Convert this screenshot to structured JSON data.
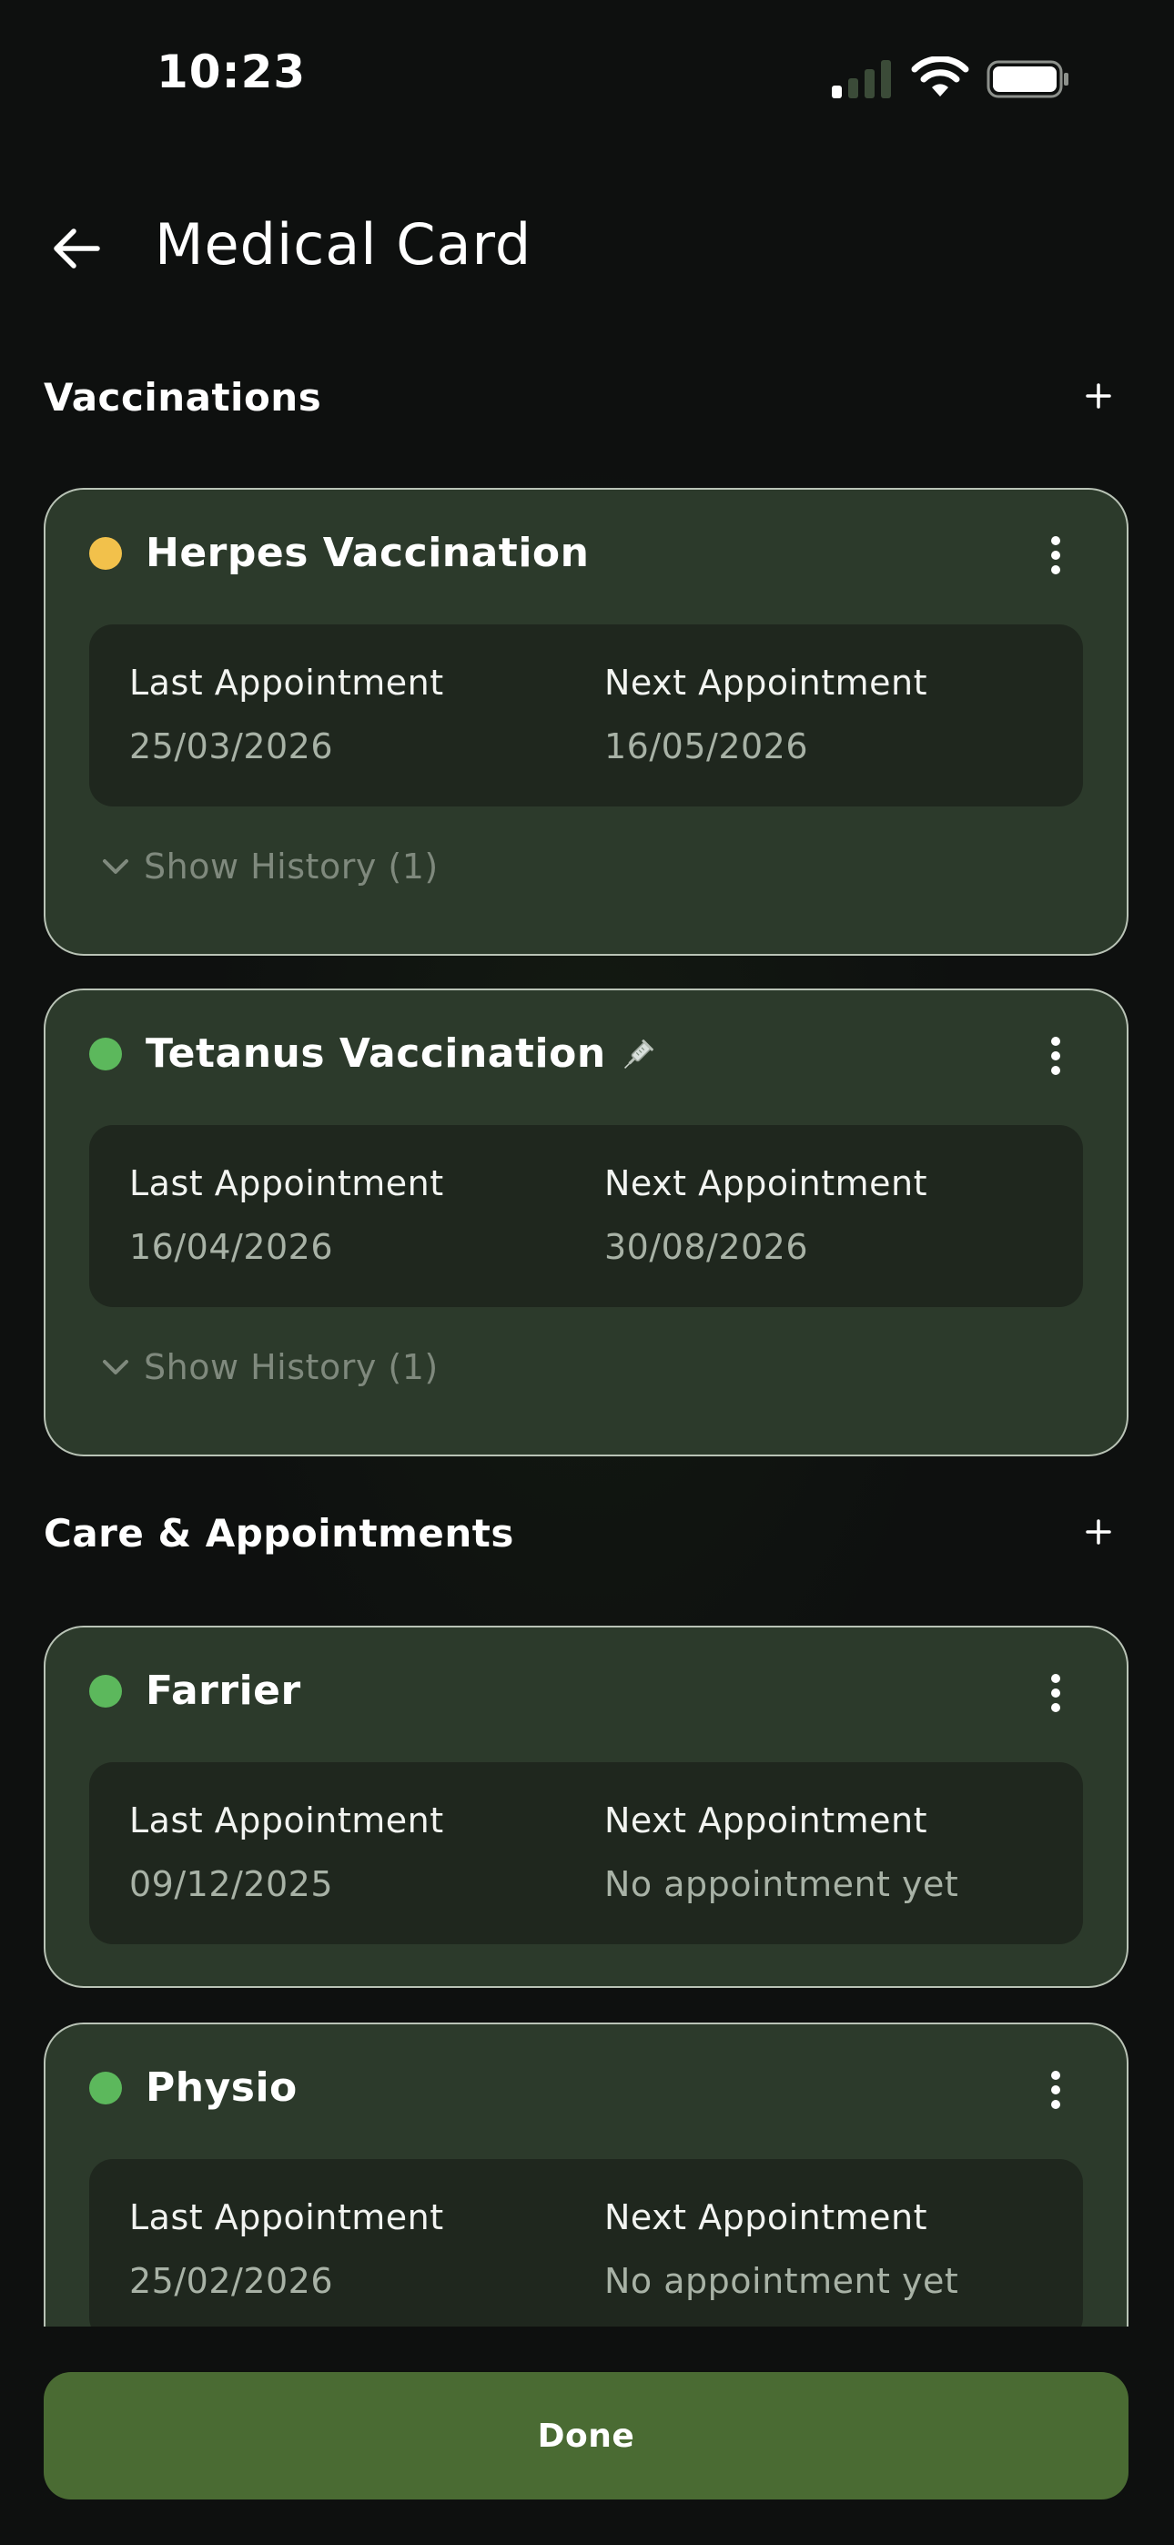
{
  "status_bar": {
    "time": "10:23"
  },
  "header": {
    "title": "Medical Card",
    "back_icon": "arrow-left-icon"
  },
  "sections": {
    "vaccinations": {
      "title": "Vaccinations",
      "add_icon": "plus-icon"
    },
    "care": {
      "title": "Care & Appointments",
      "add_icon": "plus-icon"
    }
  },
  "labels": {
    "last": "Last Appointment",
    "next": "Next Appointment"
  },
  "cards": [
    {
      "title": "Herpes Vaccination",
      "status_color": "#f2c14b",
      "last": "25/03/2026",
      "next": "16/05/2026",
      "history": "Show History (1)"
    },
    {
      "title": "Tetanus Vaccination",
      "status_color": "#5cb85c",
      "last": "16/04/2026",
      "next": "30/08/2026",
      "history": "Show History (1)",
      "icon": "syringe-icon"
    },
    {
      "title": "Farrier",
      "status_color": "#5cb85c",
      "last": "09/12/2025",
      "next": "No appointment yet"
    },
    {
      "title": "Physio",
      "status_color": "#5cb85c",
      "last": "25/02/2026",
      "next": "No appointment yet"
    }
  ],
  "footer": {
    "done_label": "Done"
  },
  "colors": {
    "accent": "#4a6b33",
    "card_bg": "#2c3a2b",
    "background": "#0e100f"
  }
}
